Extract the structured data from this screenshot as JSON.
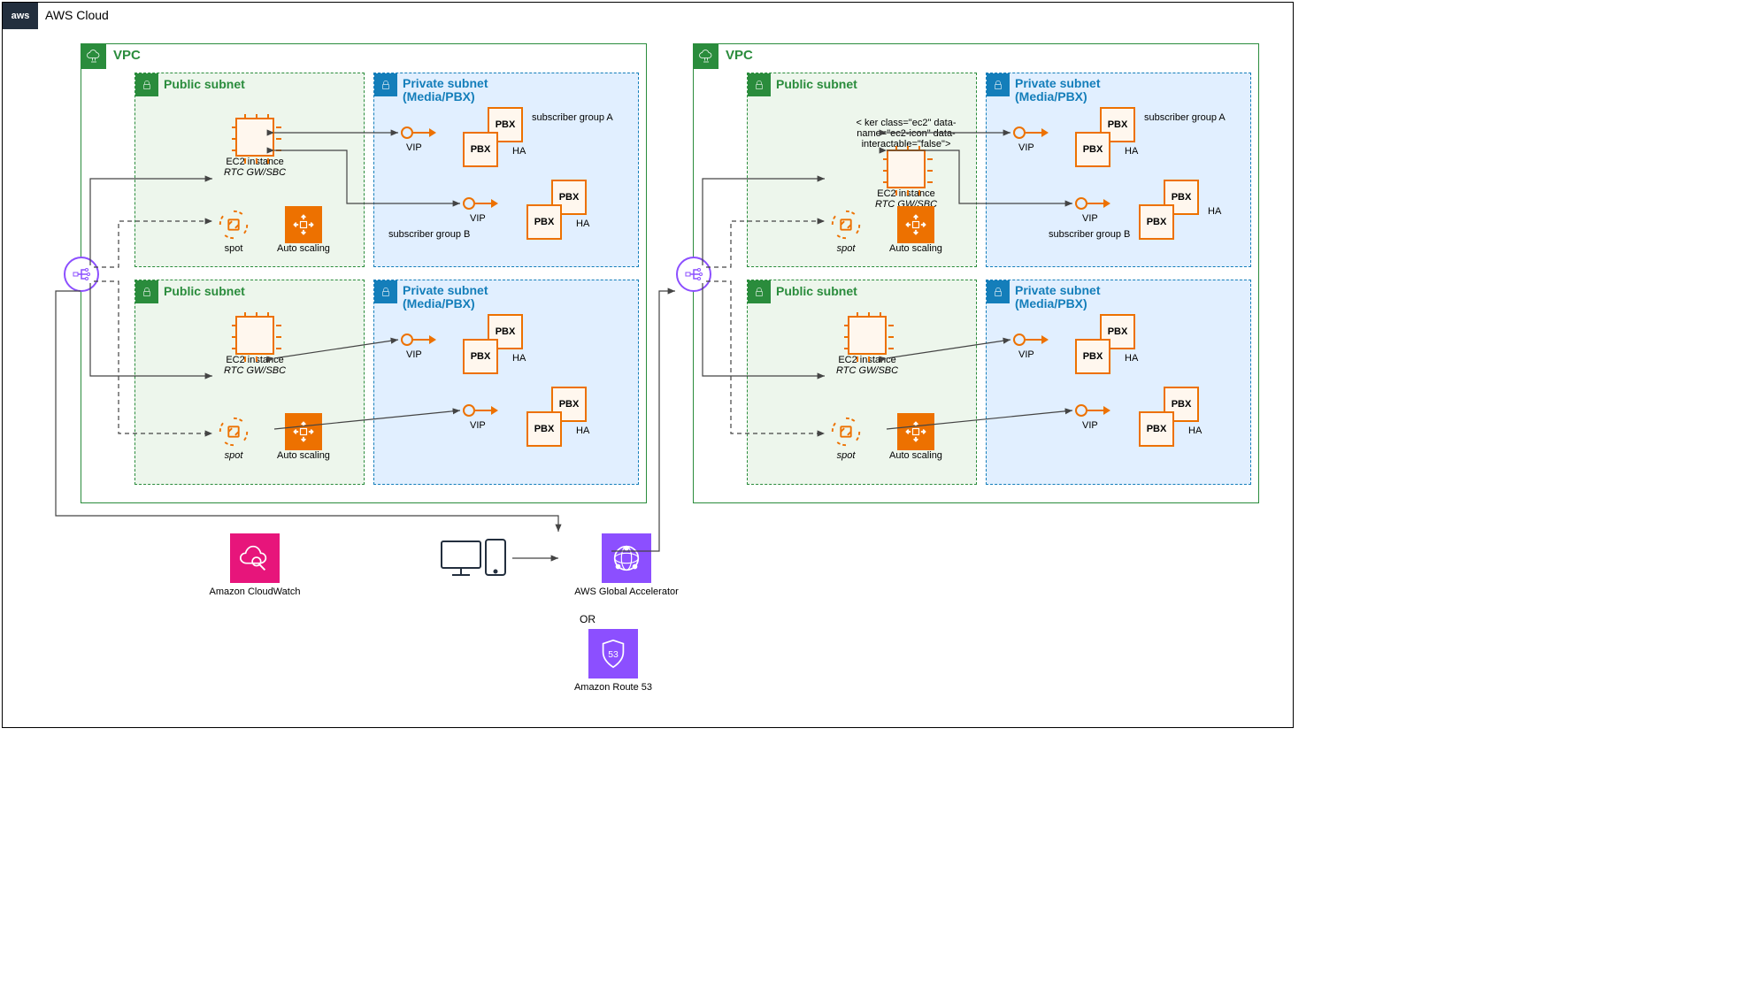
{
  "cloud_label": "AWS Cloud",
  "aws_badge": "aws",
  "vpc_label": "VPC",
  "public_subnet_label": "Public subnet",
  "private_subnet_label": "Private subnet",
  "private_subnet_sub": "(Media/PBX)",
  "ec2_label": "EC2 instance",
  "rtc_label": "RTC GW/SBC",
  "spot_label": "spot",
  "autoscale_label": "Auto scaling",
  "vip_label": "VIP",
  "pbx_label": "PBX",
  "ha_label": "HA",
  "sub_group_a": "subscriber group A",
  "sub_group_b": "subscriber group B",
  "bottom": {
    "cloudwatch": "Amazon CloudWatch",
    "accelerator": "AWS Global Accelerator",
    "or": "OR",
    "route53": "Amazon Route 53"
  }
}
